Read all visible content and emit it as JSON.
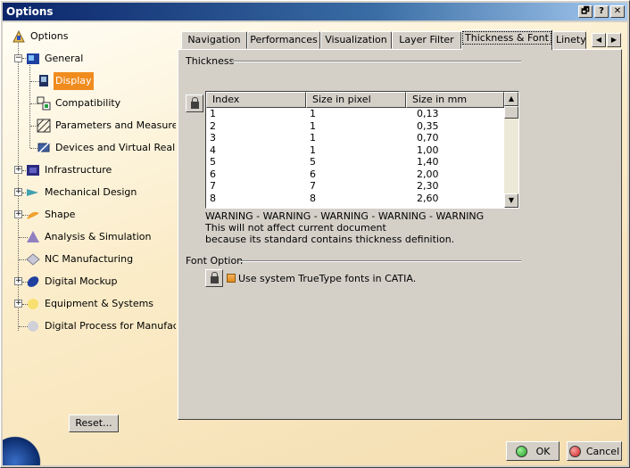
{
  "window": {
    "title": "Options",
    "controls": [
      "🗗",
      "?",
      "✕"
    ]
  },
  "tree": {
    "items": [
      {
        "label": "Options",
        "icon": "options-icon"
      },
      {
        "label": "General",
        "icon": "general-icon"
      },
      {
        "label": "Display",
        "icon": "display-icon",
        "selected": true
      },
      {
        "label": "Compatibility",
        "icon": "compatibility-icon"
      },
      {
        "label": "Parameters and Measure",
        "icon": "parameters-icon"
      },
      {
        "label": "Devices and Virtual Reality",
        "icon": "devices-icon"
      },
      {
        "label": "Infrastructure",
        "icon": "infrastructure-icon"
      },
      {
        "label": "Mechanical Design",
        "icon": "mechanical-design-icon"
      },
      {
        "label": "Shape",
        "icon": "shape-icon"
      },
      {
        "label": "Analysis & Simulation",
        "icon": "analysis-icon"
      },
      {
        "label": "NC Manufacturing",
        "icon": "nc-manufacturing-icon"
      },
      {
        "label": "Digital Mockup",
        "icon": "digital-mockup-icon"
      },
      {
        "label": "Equipment & Systems",
        "icon": "equipment-icon"
      },
      {
        "label": "Digital Process for Manufacturin",
        "icon": "digital-process-icon"
      }
    ],
    "reset_label": "Reset..."
  },
  "tabs": {
    "items": [
      "Navigation",
      "Performances",
      "Visualization",
      "Layer Filter",
      "Thickness & Font",
      "Linetyp"
    ],
    "active": "Thickness & Font",
    "scroll_left": "◀",
    "scroll_right": "▶"
  },
  "thickness": {
    "title": "Thickness",
    "columns": [
      "Index",
      "Size in pixel",
      "Size in mm"
    ],
    "rows": [
      [
        "1",
        "1",
        "0,13"
      ],
      [
        "2",
        "1",
        "0,35"
      ],
      [
        "3",
        "1",
        "0,70"
      ],
      [
        "4",
        "1",
        "1,00"
      ],
      [
        "5",
        "5",
        "1,40"
      ],
      [
        "6",
        "6",
        "2,00"
      ],
      [
        "7",
        "7",
        "2,30"
      ],
      [
        "8",
        "8",
        "2,60"
      ]
    ],
    "warning_lines": [
      "WARNING - WARNING - WARNING - WARNING - WARNING",
      "This will not affect current document",
      "because its standard contains thickness definition."
    ]
  },
  "font_option": {
    "title": "Font Option",
    "checkbox_label": "Use system TrueType fonts in CATIA."
  },
  "buttons": {
    "ok": "OK",
    "cancel": "Cancel"
  },
  "colors": {
    "selected_bg": "#f08c1e",
    "title_bar": "#0a246a",
    "ok_dot": "#1ea01e",
    "cancel_dot": "#d02020"
  }
}
